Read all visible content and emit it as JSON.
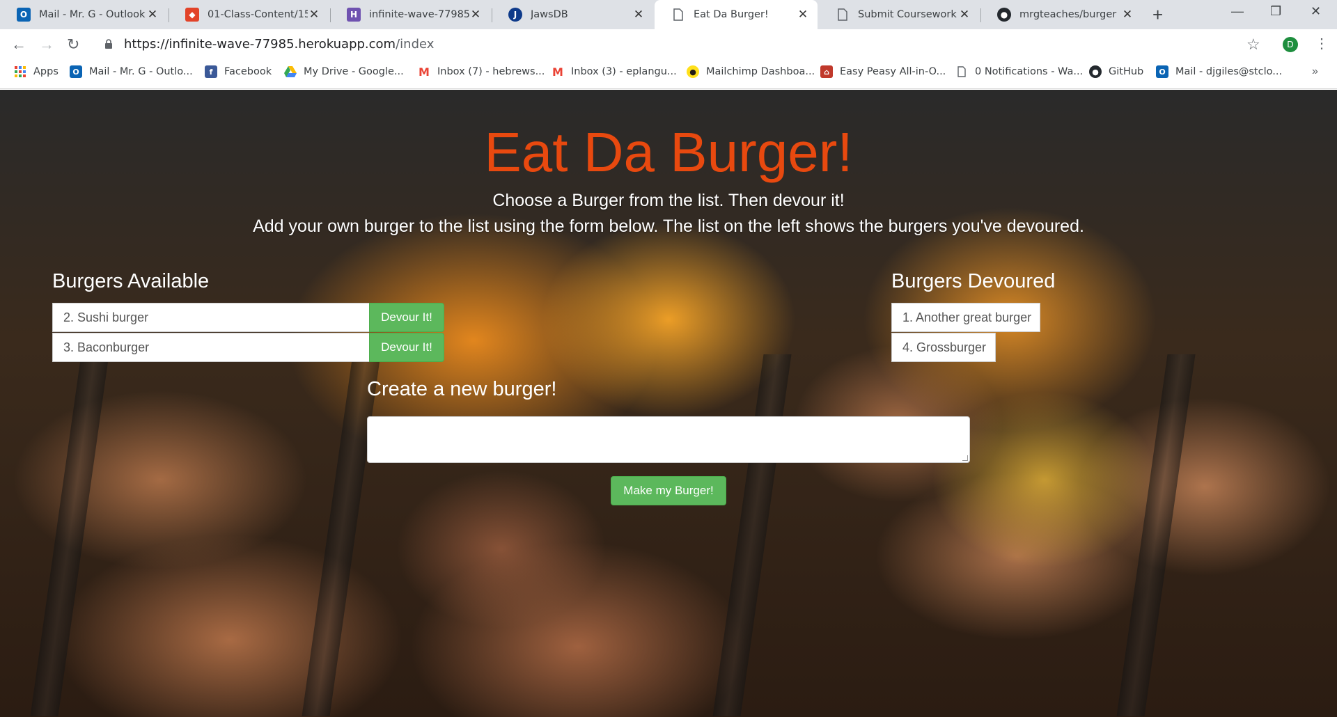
{
  "browser": {
    "tabs": [
      {
        "title": "Mail - Mr. G - Outlook",
        "icon": "outlook-icon",
        "color": "#0a64b4"
      },
      {
        "title": "01-Class-Content/15-s",
        "icon": "gitlab-icon",
        "color": "#e24329"
      },
      {
        "title": "infinite-wave-77985 | H",
        "icon": "heroku-icon",
        "color": "#6f52b0"
      },
      {
        "title": "JawsDB",
        "icon": "jawsdb-icon",
        "color": "#0e3a8a"
      },
      {
        "title": "Eat Da Burger!",
        "icon": "page-icon",
        "color": "#5f6368"
      },
      {
        "title": "Submit Coursework | B",
        "icon": "page-icon",
        "color": "#5f6368"
      },
      {
        "title": "mrgteaches/burger",
        "icon": "github-icon",
        "color": "#24292e"
      }
    ],
    "active_tab_index": 4,
    "url_host": "https://infinite-wave-77985.herokuapp.com",
    "url_path": "/index",
    "profile_initial": "D",
    "bookmarks": [
      {
        "label": "Apps",
        "icon": "apps-grid-icon"
      },
      {
        "label": "Mail - Mr. G - Outlo...",
        "icon": "outlook-icon"
      },
      {
        "label": "Facebook",
        "icon": "facebook-icon"
      },
      {
        "label": "My Drive - Google...",
        "icon": "google-drive-icon"
      },
      {
        "label": "Inbox (7) - hebrews...",
        "icon": "gmail-icon"
      },
      {
        "label": "Inbox (3) - eplangu...",
        "icon": "gmail-icon"
      },
      {
        "label": "Mailchimp Dashboa...",
        "icon": "mailchimp-icon"
      },
      {
        "label": "Easy Peasy All-in-O...",
        "icon": "schoolhouse-icon"
      },
      {
        "label": "0 Notifications - Wa...",
        "icon": "page-icon"
      },
      {
        "label": "GitHub",
        "icon": "github-icon"
      },
      {
        "label": "Mail - djgiles@stclo...",
        "icon": "outlook-icon"
      }
    ]
  },
  "page": {
    "title": "Eat Da Burger!",
    "subtitle_1": "Choose a Burger from the list. Then devour it!",
    "subtitle_2": "Add your own burger to the list using the form below. The list on the left shows the burgers you've devoured.",
    "available_heading": "Burgers Available",
    "devoured_heading": "Burgers Devoured",
    "available": [
      {
        "label": "2. Sushi burger",
        "button": "Devour It!"
      },
      {
        "label": "3. Baconburger",
        "button": "Devour It!"
      }
    ],
    "devoured": [
      {
        "label": "1. Another great burger"
      },
      {
        "label": "4. Grossburger"
      }
    ],
    "form_label": "Create a new burger!",
    "textarea_value": "",
    "submit_label": "Make my Burger!",
    "button_color": "#5cb85c",
    "title_color": "#e8490f"
  }
}
